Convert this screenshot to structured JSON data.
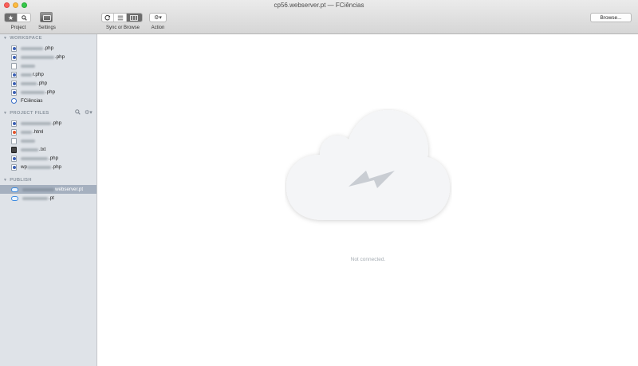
{
  "window": {
    "title": "cp56.webserver.pt — FCiências"
  },
  "toolbar": {
    "project_label": "Project",
    "settings_label": "Settings",
    "sync_label": "Sync or Browse",
    "action_label": "Action",
    "browse_label": "Browse..."
  },
  "sidebar": {
    "workspace": {
      "header": "WORKSPACE",
      "items": [
        {
          "label": ".php",
          "icon": "php-file-icon"
        },
        {
          "label": ".php",
          "icon": "php-file-icon"
        },
        {
          "label": "",
          "icon": "blank-file-icon"
        },
        {
          "label": "r.php",
          "icon": "php-file-icon"
        },
        {
          "label": ".php",
          "icon": "php-file-icon"
        },
        {
          "label": ".php",
          "icon": "php-file-icon"
        },
        {
          "label": "FCiências",
          "icon": "site-icon"
        }
      ]
    },
    "project_files": {
      "header": "PROJECT FILES",
      "items": [
        {
          "label": ".php",
          "icon": "php-file-icon"
        },
        {
          "label": ".html",
          "icon": "html-file-icon"
        },
        {
          "label": "",
          "icon": "blank-file-icon"
        },
        {
          "label": ".txt",
          "icon": "txt-file-icon"
        },
        {
          "label": ".php",
          "icon": "php-file-icon"
        },
        {
          "label": ".php",
          "icon": "php-file-icon",
          "prefix": "wp"
        }
      ]
    },
    "publish": {
      "header": "PUBLISH",
      "items": [
        {
          "label": "webserver.pt",
          "icon": "cloud-icon",
          "selected": true
        },
        {
          "label": ".pt",
          "icon": "cloud-icon"
        }
      ]
    }
  },
  "main": {
    "status": "Not connected."
  },
  "colors": {
    "sidebar_bg": "#dfe3e8",
    "selected_row": "#a5b0bf",
    "cloud": "#f4f5f7"
  }
}
